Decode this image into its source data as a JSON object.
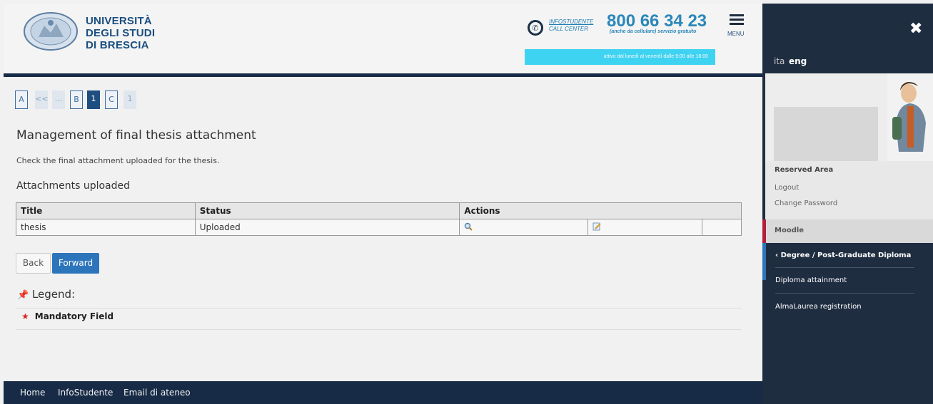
{
  "header": {
    "university_lines": [
      "UNIVERSITÀ",
      "DEGLI STUDI",
      "DI BRESCIA"
    ],
    "infostudente": "INFOSTUDENTE",
    "call_center": "CALL CENTER",
    "phone_number": "800 66 34 23",
    "phone_subtitle": "(anche da cellulare) servizio gratuito",
    "menu_label": "MENU",
    "hours": "attivo dal lunedì al venerdì dalle 9:00 alle 18:00"
  },
  "steps": [
    {
      "label": "A",
      "style": "outline"
    },
    {
      "label": "<<",
      "style": "light"
    },
    {
      "label": "...",
      "style": "light"
    },
    {
      "label": "B",
      "style": "outline"
    },
    {
      "label": "1",
      "style": "active"
    },
    {
      "label": "C",
      "style": "outline"
    },
    {
      "label": "1",
      "style": "light"
    }
  ],
  "page": {
    "title": "Management of final thesis attachment",
    "description": "Check the final attachment uploaded for the thesis.",
    "section_title": "Attachments uploaded"
  },
  "table": {
    "headers": {
      "title": "Title",
      "status": "Status",
      "actions": "Actions"
    },
    "rows": [
      {
        "title": "thesis",
        "status": "Uploaded",
        "view_icon": "magnifier-icon",
        "edit_icon": "edit-icon"
      }
    ]
  },
  "buttons": {
    "back": "Back",
    "forward": "Forward"
  },
  "legend": {
    "title": "Legend:",
    "mandatory": "Mandatory Field"
  },
  "footer": {
    "links": [
      "Home",
      "InfoStudente",
      "Email di ateneo"
    ]
  },
  "sidebar": {
    "lang_ita": "ita",
    "lang_eng": "eng",
    "reserved_area": "Reserved Area",
    "logout": "Logout",
    "change_password": "Change Password",
    "moodle": "Moodle",
    "degree": "Degree / Post-Graduate Diploma",
    "items": [
      "Diploma attainment",
      "AlmaLaurea registration"
    ]
  },
  "colors": {
    "navy": "#172b47",
    "accent_blue": "#2d75bb",
    "cyan": "#3fd3f2",
    "moodle_red": "#b4203a"
  }
}
